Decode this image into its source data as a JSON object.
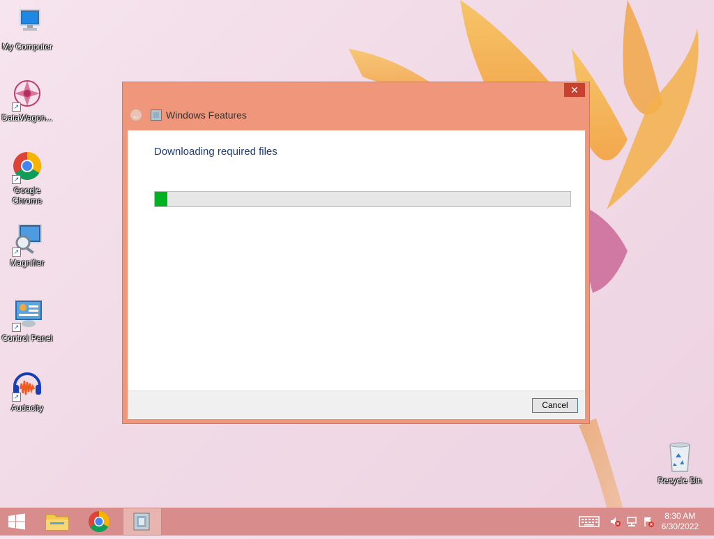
{
  "desktop": {
    "icons": [
      {
        "label": "My Computer"
      },
      {
        "label": "DataWagon..."
      },
      {
        "label": "Google Chrome"
      },
      {
        "label": "Magnifier"
      },
      {
        "label": "Control Panel"
      },
      {
        "label": "Audacity"
      },
      {
        "label": "Recycle Bin"
      }
    ]
  },
  "dialog": {
    "title": "Windows Features",
    "close_label": "✕",
    "heading": "Downloading required files",
    "progress_percent": 3,
    "cancel_label": "Cancel"
  },
  "taskbar": {
    "time": "8:30 AM",
    "date": "6/30/2022"
  },
  "colors": {
    "dialog_frame": "#f0967a",
    "progress_fill": "#06b025",
    "taskbar": "#d88c8b"
  }
}
